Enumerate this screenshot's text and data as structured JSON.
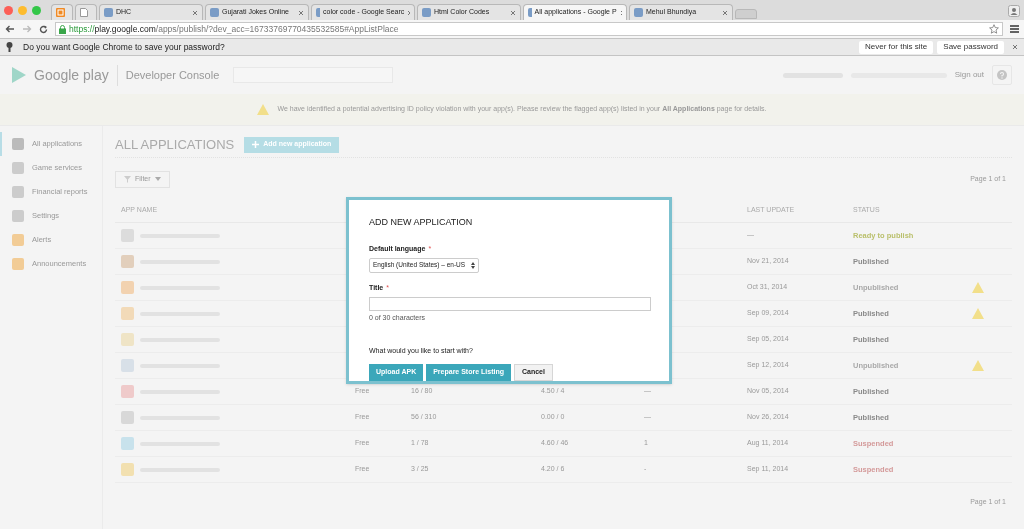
{
  "tabs": [
    {
      "kind": "icon",
      "selected": false
    },
    {
      "kind": "blank",
      "selected": false
    },
    {
      "kind": "page",
      "label": "DHC",
      "selected": false
    },
    {
      "kind": "page",
      "label": "Gujarati Jokes Online",
      "selected": false
    },
    {
      "kind": "page",
      "label": "color code - Google Searc",
      "selected": false
    },
    {
      "kind": "page",
      "label": "Html Color Codes",
      "selected": false
    },
    {
      "kind": "page",
      "label": "All applications - Google P",
      "selected": true
    },
    {
      "kind": "page",
      "label": "Mehul Bhundiya",
      "selected": false
    }
  ],
  "address": {
    "scheme": "https://",
    "host": "play.google.com",
    "path": "/apps/publish/?dev_acc=16733769770435532585#AppListPlace"
  },
  "password_bar": {
    "message": "Do you want Google Chrome to save your password?",
    "buttons": [
      "Never for this site",
      "Save password"
    ]
  },
  "header": {
    "brand": "Google play",
    "product": "Developer Console",
    "sign_out": "Sign out"
  },
  "banner": {
    "text": "We have identified a potential advertising ID policy violation with your app(s). Please review the flagged app(s) listed in your **All Applications** page for details."
  },
  "sidebar": {
    "items": [
      {
        "label": "All applications",
        "selected": true
      },
      {
        "label": "Game services",
        "selected": false
      },
      {
        "label": "Financial reports",
        "selected": false
      },
      {
        "label": "Settings",
        "selected": false
      },
      {
        "label": "Alerts",
        "selected": false
      },
      {
        "label": "Announcements",
        "selected": false
      }
    ]
  },
  "main": {
    "title": "ALL APPLICATIONS",
    "add_button": "Add new application",
    "filter": "Filter",
    "page_top": "Page 1 of 1",
    "page_bottom": "Page 1 of 1",
    "columns": [
      "APP NAME",
      "LAST UPDATE",
      "STATUS"
    ],
    "rows": [
      {
        "updated": "—",
        "status": "Ready to publish",
        "color": "#b9bf6a",
        "warning": false
      },
      {
        "updated": "Nov 21, 2014",
        "status": "Published",
        "color": "#8a8a8a",
        "warning": false
      },
      {
        "updated": "Oct 31, 2014",
        "status": "Unpublished",
        "color": "#a8a8a8",
        "warning": true
      },
      {
        "updated": "Sep 09, 2014",
        "status": "Published",
        "color": "#8a8a8a",
        "warning": true
      },
      {
        "updated": "Sep 05, 2014",
        "status": "Published",
        "color": "#8a8a8a",
        "warning": false
      },
      {
        "updated": "Sep 12, 2014",
        "status": "Unpublished",
        "color": "#a8a8a8",
        "warning": true
      },
      {
        "price": "Free",
        "installs": "16 / 80",
        "rating": "4.50 / 4",
        "crashes": "—",
        "updated": "Nov 05, 2014",
        "status": "Published",
        "color": "#8a8a8a",
        "warning": false
      },
      {
        "price": "Free",
        "installs": "56 / 310",
        "rating": "0.00 / 0",
        "crashes": "—",
        "updated": "Nov 26, 2014",
        "status": "Published",
        "color": "#8a8a8a",
        "warning": false
      },
      {
        "price": "Free",
        "installs": "1 / 78",
        "rating": "4.60 / 46",
        "crashes": "1",
        "updated": "Aug 11, 2014",
        "status": "Suspended",
        "color": "#d49a9a",
        "warning": false
      },
      {
        "price": "Free",
        "installs": "3 / 25",
        "rating": "4.20 / 6",
        "crashes": "-",
        "updated": "Sep 11, 2014",
        "status": "Suspended",
        "color": "#d49a9a",
        "warning": false
      }
    ]
  },
  "dialog": {
    "title": "ADD NEW APPLICATION",
    "language_label": "Default language",
    "language_value": "English (United States) – en-US",
    "title_label": "Title",
    "required_mark": "*",
    "counter": "0 of 30 characters",
    "question": "What would you like to start with?",
    "buttons": [
      {
        "label": "Upload APK",
        "kind": "primary"
      },
      {
        "label": "Prepare Store Listing",
        "kind": "primary"
      },
      {
        "label": "Cancel",
        "kind": "secondary"
      }
    ]
  }
}
